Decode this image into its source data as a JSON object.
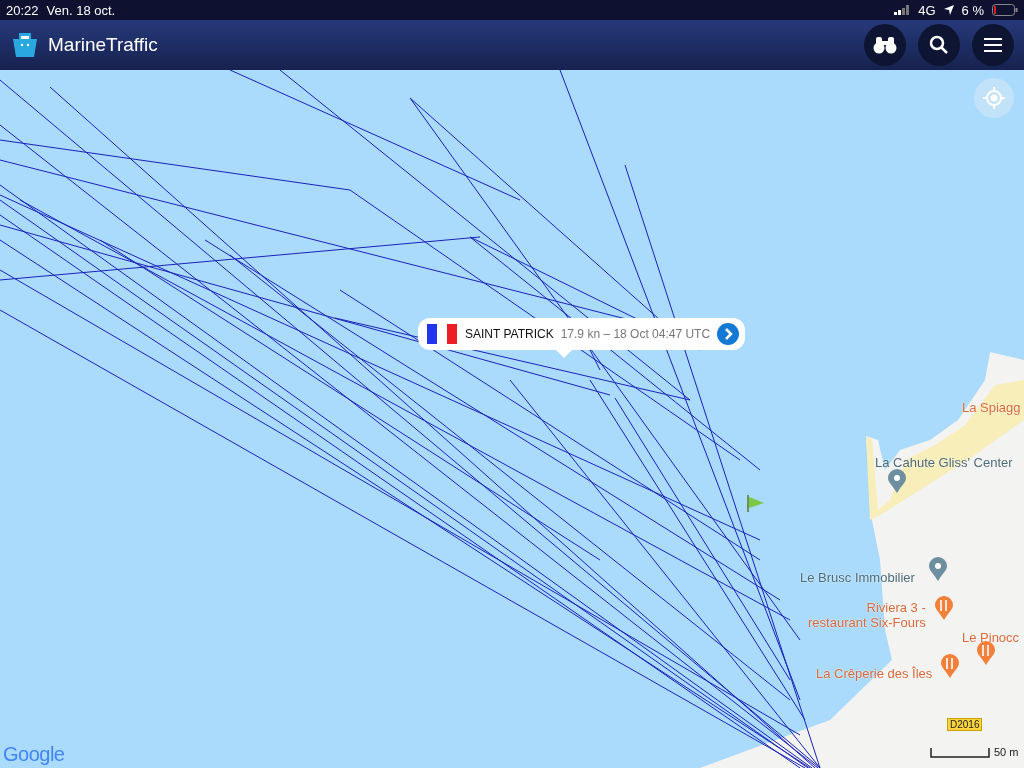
{
  "status_bar": {
    "time": "20:22",
    "date": "Ven. 18 oct.",
    "network": "4G",
    "battery": "6 %"
  },
  "header": {
    "app_name": "MarineTraffic"
  },
  "popup": {
    "vessel": "SAINT PATRICK",
    "details": "17.9 kn – 18 Oct 04:47 UTC"
  },
  "map": {
    "places": [
      {
        "name": "La Spiagg",
        "kind": "text"
      },
      {
        "name": "La Cahute Gliss' Center",
        "kind": "poi"
      },
      {
        "name": "Le Brusc Immobilier",
        "kind": "poi"
      },
      {
        "name": "Riviera 3 -\nrestaurant Six-Fours",
        "kind": "restaurant"
      },
      {
        "name": "Le Pinocc",
        "kind": "restaurant"
      },
      {
        "name": "La Crêperie des Îles",
        "kind": "restaurant"
      }
    ],
    "road_label": "D2016",
    "scale": "50 m",
    "attribution": "Google"
  }
}
